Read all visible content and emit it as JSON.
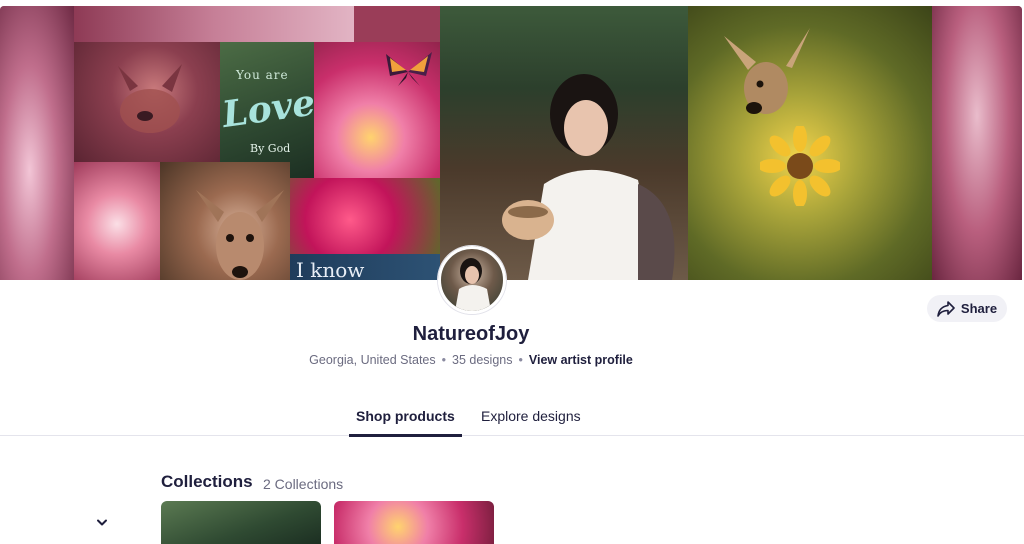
{
  "banner": {
    "tile_texts": {
      "you_are": "You are",
      "loved": "Loved",
      "by_god": "By God",
      "i_know": "I know"
    }
  },
  "artist": {
    "name": "NatureofJoy",
    "location": "Georgia, United States",
    "designs": "35 designs",
    "view_profile": "View artist profile"
  },
  "share": {
    "label": "Share"
  },
  "tabs": [
    {
      "label": "Shop products",
      "active": true
    },
    {
      "label": "Explore designs",
      "active": false
    }
  ],
  "collections": {
    "title": "Collections",
    "count": "2 Collections"
  },
  "icons": {
    "share": "share-arrow-icon",
    "chevron": "chevron-down-icon"
  },
  "colors": {
    "text_primary": "#1f1f3d",
    "text_secondary": "#6b6b80",
    "share_bg": "#f1f1f6"
  }
}
